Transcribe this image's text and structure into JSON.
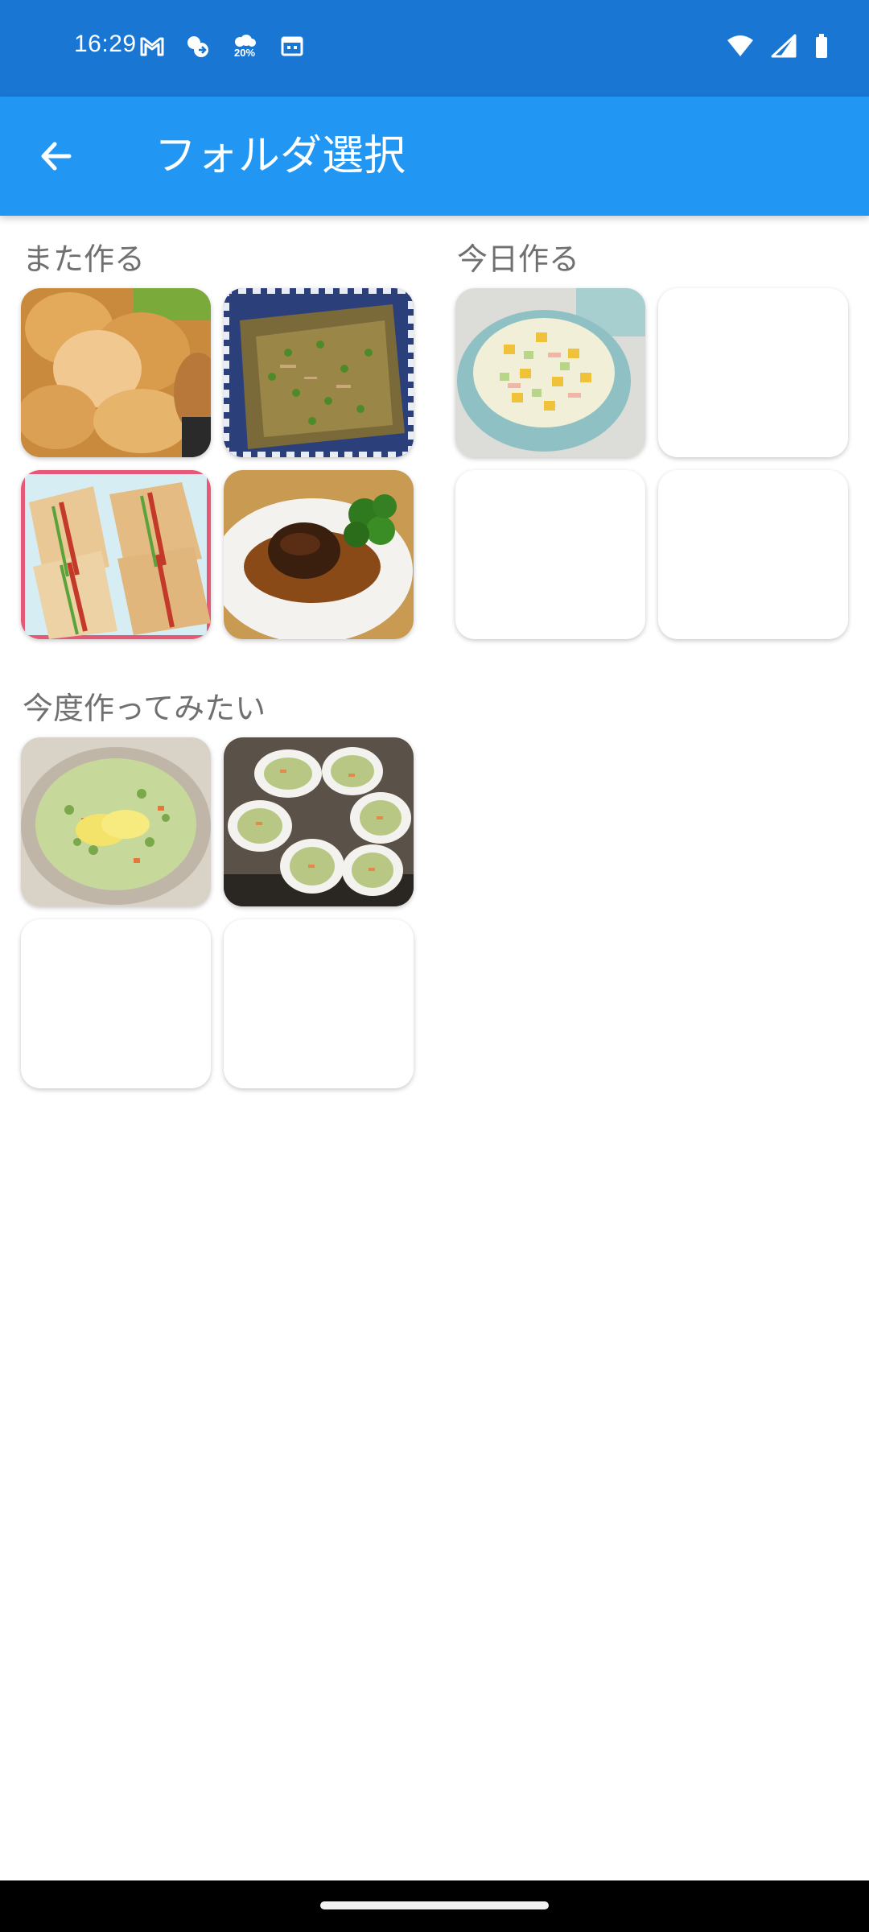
{
  "status_bar": {
    "time": "16:29",
    "weather_percent": "20%",
    "icons_left": [
      "gmail-icon",
      "weather-sun-cloud-icon",
      "weather-percent-icon",
      "calendar-icon"
    ],
    "icons_right": [
      "wifi-icon",
      "cellular-signal-icon",
      "battery-icon"
    ]
  },
  "app_bar": {
    "title": "フォルダ選択",
    "back_icon": "arrow-back-icon"
  },
  "folders": [
    {
      "title": "また作る",
      "tiles": [
        "fried-chicken-photo",
        "grilled-eggplant-photo",
        "sandwich-photo",
        "hamburg-steak-photo"
      ]
    },
    {
      "title": "今日作る",
      "tiles": [
        "corn-salad-photo",
        "empty",
        "empty",
        "empty"
      ]
    },
    {
      "title": "今度作ってみたい",
      "tiles": [
        "green-soup-photo",
        "coleslaw-cups-photo",
        "empty",
        "empty"
      ]
    }
  ],
  "colors": {
    "status_bar": "#1976D2",
    "app_bar": "#2196F3",
    "folder_title": "#707070",
    "background": "#FFFFFF"
  }
}
